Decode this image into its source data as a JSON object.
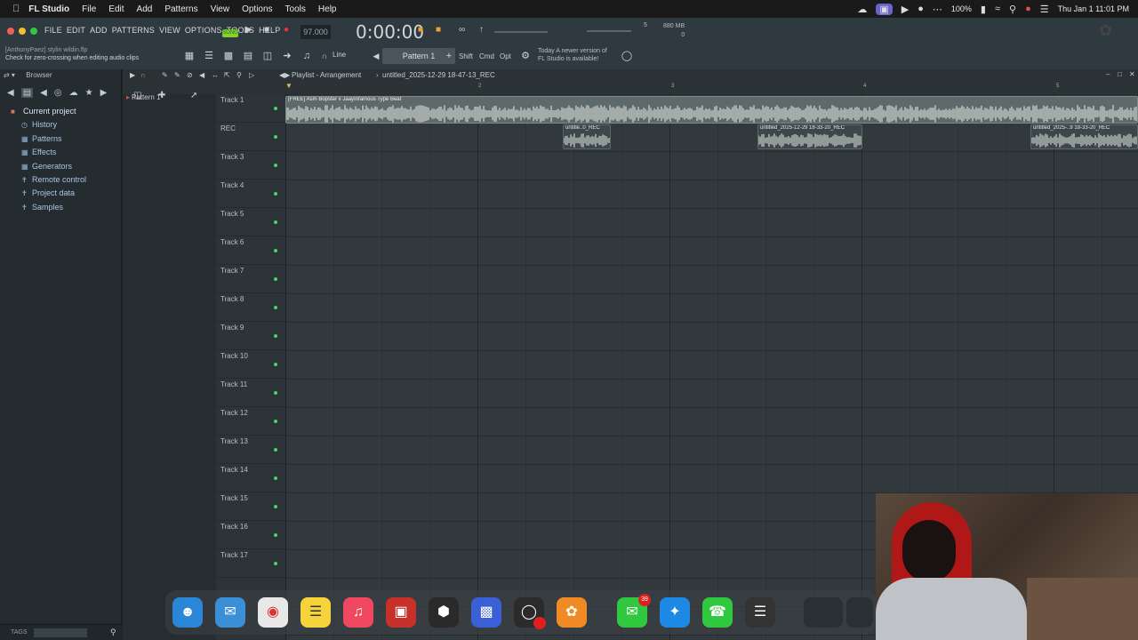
{
  "menubar": {
    "app_name": "FL Studio",
    "items": [
      "File",
      "Edit",
      "Add",
      "Patterns",
      "View",
      "Options",
      "Tools",
      "Help"
    ],
    "battery": "100%",
    "clock": "Thu Jan 1  11:01 PM"
  },
  "fl": {
    "menu_items": [
      "FILE",
      "EDIT",
      "ADD",
      "PATTERNS",
      "VIEW",
      "OPTIONS",
      "TOOLS",
      "HELP"
    ],
    "song_mode": "SONG",
    "tempo": "97.000",
    "time": "0:00:00",
    "memory": "880 MB",
    "memory_sub": "0",
    "cpu": "5",
    "project_file": "[AnthonyPaez] stylin wildin.flp",
    "hint": "Check for zero-crossing when editing audio clips",
    "snap": "Line",
    "pattern": "Pattern 1",
    "mods": [
      "Shift",
      "Cmd",
      "Opt"
    ],
    "news_line1": "Today  A newer version of",
    "news_line2": "FL Studio is available!"
  },
  "browser": {
    "title": "Browser",
    "root": "Current project",
    "items": [
      "History",
      "Patterns",
      "Effects",
      "Generators",
      "Remote control",
      "Project data",
      "Samples"
    ],
    "tags_label": "TAGS"
  },
  "playlist": {
    "title": "Playlist - Arrangement",
    "arrangement_name": "untitled_2025-12-29 18-47-13_REC",
    "picker_pattern": "Pattern 1",
    "ruler_marks": [
      "2",
      "3",
      "4",
      "5"
    ],
    "tracks": [
      "Track 1",
      "REC",
      "Track 3",
      "Track 4",
      "Track 5",
      "Track 6",
      "Track 7",
      "Track 8",
      "Track 9",
      "Track 10",
      "Track 11",
      "Track 12",
      "Track 13",
      "Track 14",
      "Track 15",
      "Track 16",
      "Track 17"
    ],
    "clips": {
      "beat": "[FREE] Asm Bopster x JaayInfamous Type Beat",
      "rec1": "untitle..0_REC",
      "rec2": "untitled_2025-12-29 18-33-20_REC",
      "rec3": "untitled_2025-..9 18-33-20_REC"
    }
  },
  "dock": {
    "badge_messages": "39"
  },
  "colors": {
    "accent_green": "#8bd12a",
    "track_led": "#4fd35a",
    "record_red": "#e02020"
  }
}
